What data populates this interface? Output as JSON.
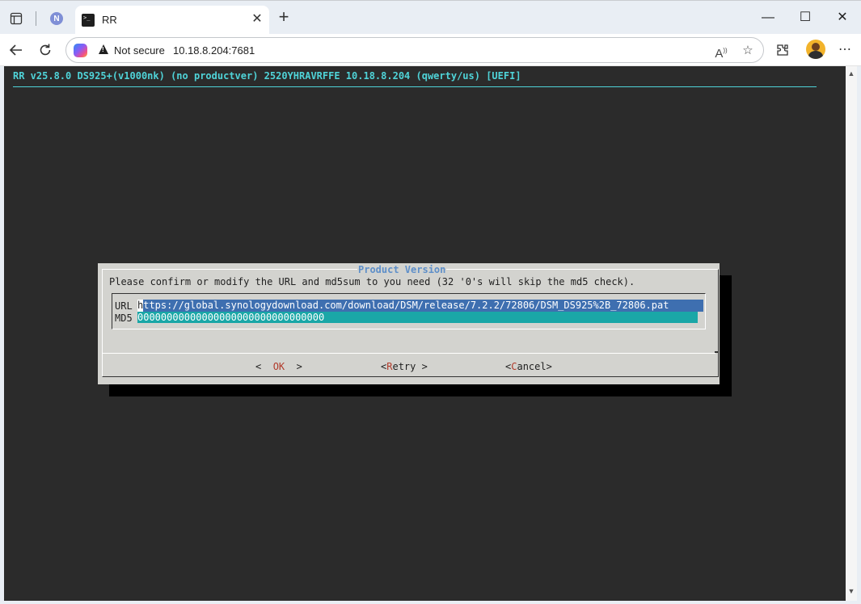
{
  "browser": {
    "tab_title": "RR",
    "tab_close": "✕",
    "new_tab": "+",
    "security_label": "Not secure",
    "url": "10.18.8.204:7681",
    "pinned_tab_glyph": "N",
    "window_controls": {
      "minimize": "—",
      "maximize": "☐",
      "close": "✕"
    },
    "icons": {
      "tab_actions": "tab-actions-icon",
      "back": "back-arrow-icon",
      "refresh": "refresh-icon",
      "copilot": "copilot-icon",
      "read_aloud": "read-aloud-icon",
      "favorite": "star-icon",
      "extensions": "extensions-icon",
      "profile": "profile-avatar",
      "menu": "more-menu-icon"
    }
  },
  "terminal": {
    "header": "RR v25.8.0 DS925+(v1000nk) (no productver) 2520YHRAVRFFE 10.18.8.204 (qwerty/us) [UEFI]",
    "colors": {
      "background": "#2b2b2b",
      "header": "#4fd3d8",
      "dialog": "#d3d3cf",
      "title": "#5e8fc9",
      "url_field": "#3e6fb0",
      "md5_field": "#1aa7a7",
      "hotkey": "#b13a2a"
    }
  },
  "dialog": {
    "title": "Product Version",
    "prompt": "Please confirm or modify the URL and md5sum to you need (32 '0's will skip the md5 check).",
    "fields": {
      "url_label": "URL",
      "url_first_char": "h",
      "url_rest": "ttps://global.synologydownload.com/download/DSM/release/7.2.2/72806/DSM_DS925%2B_72806.pat",
      "md5_label": "MD5",
      "md5_value": "00000000000000000000000000000000"
    },
    "buttons": {
      "ok_left": "<  ",
      "ok_label": "OK",
      "ok_right": "  >",
      "retry_left": "<",
      "retry_hot": "R",
      "retry_rest": "etry >",
      "cancel_left": "<",
      "cancel_hot": "C",
      "cancel_rest": "ancel>"
    }
  }
}
